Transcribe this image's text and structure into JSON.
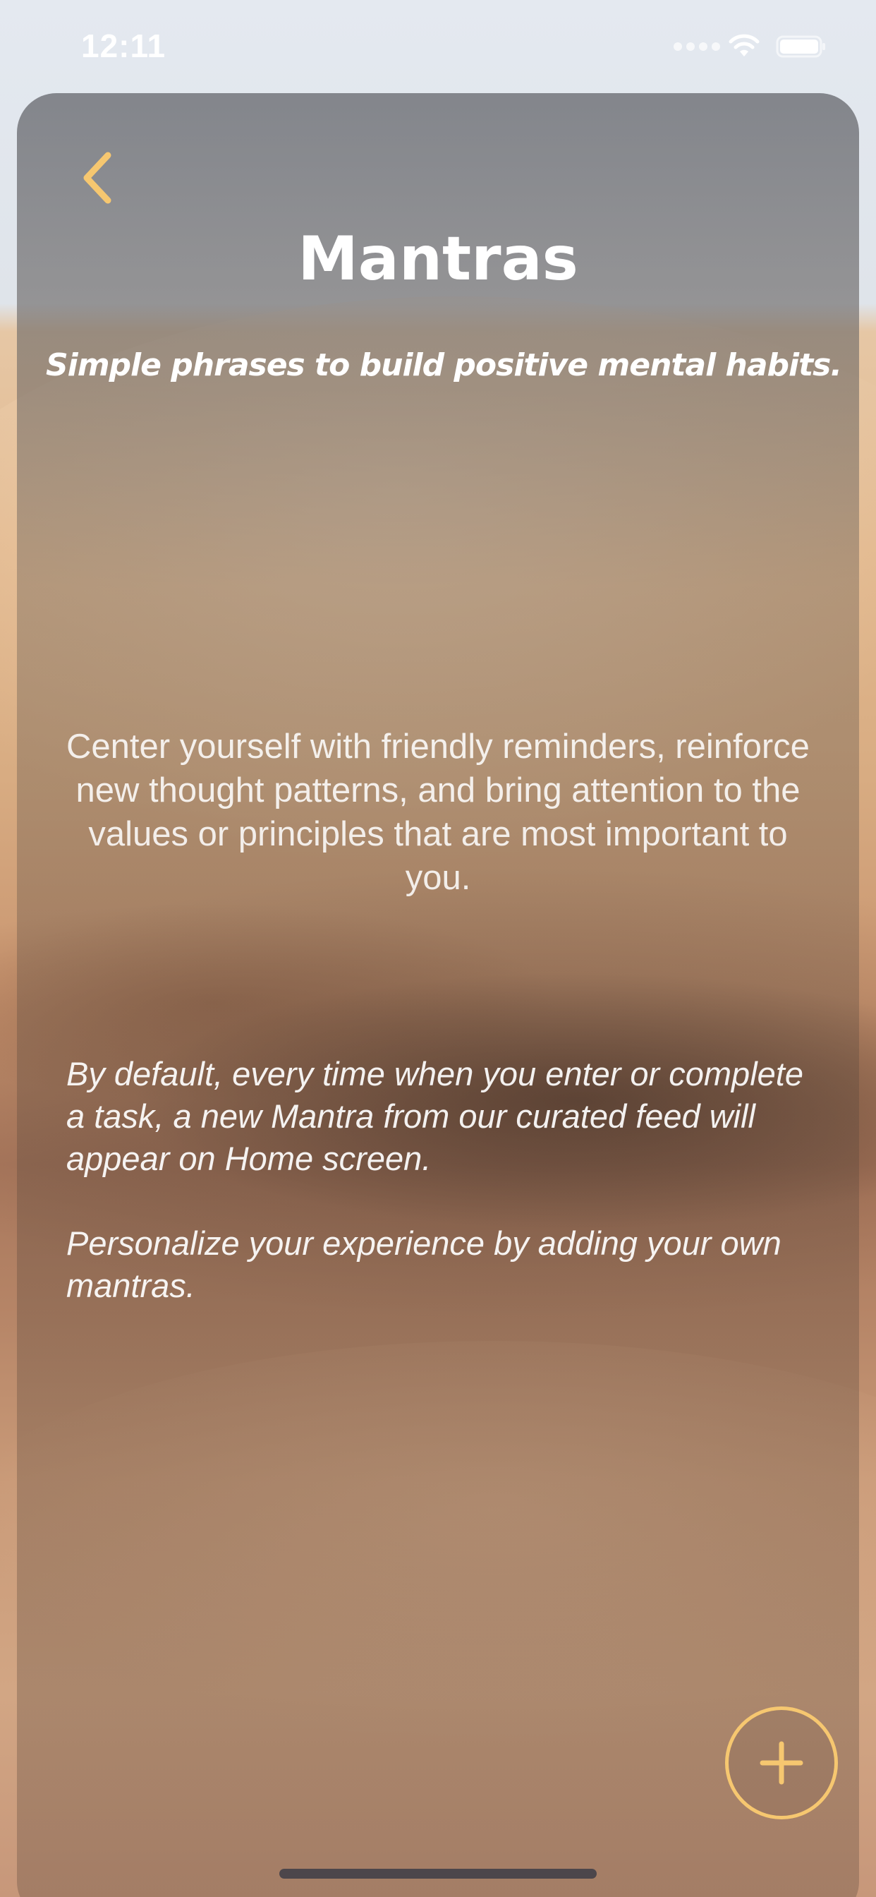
{
  "status_bar": {
    "time": "12:11"
  },
  "header": {
    "back_icon": "chevron-left-icon",
    "title": "Mantras",
    "subtitle": "Simple phrases to build positive mental habits."
  },
  "main": {
    "description": "Center yourself with friendly reminders, reinforce new thought patterns, and bring attention to the values or principles that are most important to you.",
    "info_paragraphs": [
      "By default, every time when you enter or complete a task, a new Mantra from our curated feed will appear on Home screen.",
      "Personalize your experience by adding your own mantras."
    ]
  },
  "actions": {
    "add_icon": "plus-icon"
  },
  "colors": {
    "accent": "#f6c770",
    "title_text": "#ffffff"
  }
}
